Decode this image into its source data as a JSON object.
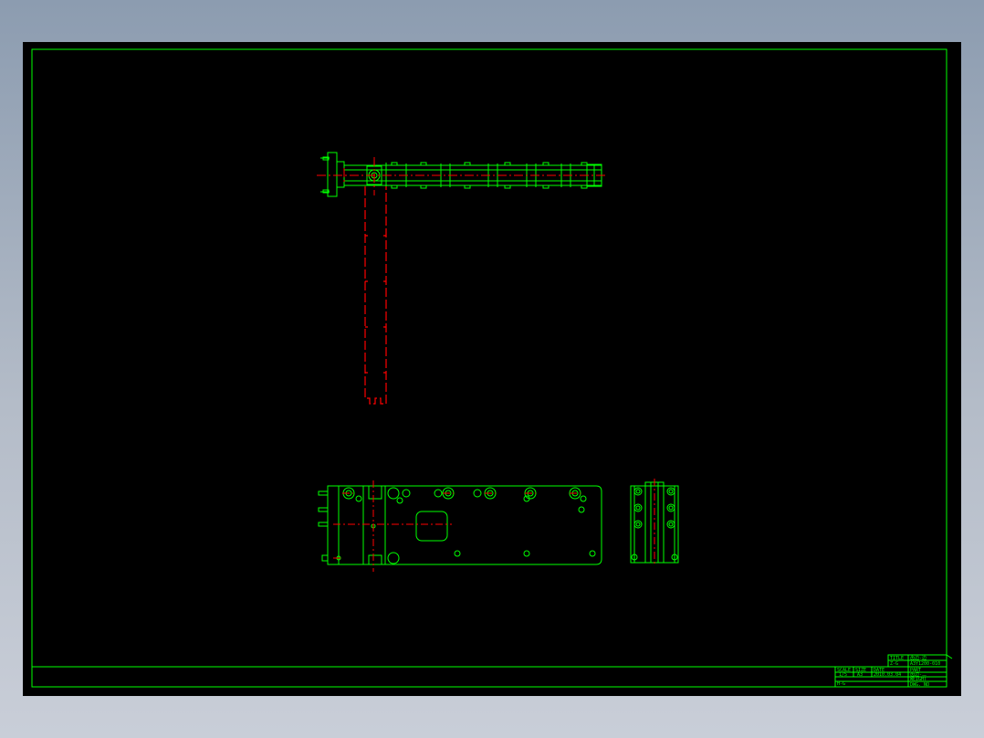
{
  "drawing": {
    "background_color": "#000000",
    "line_color": "#00ff00",
    "center_line_color": "#ff0000"
  },
  "title_block": {
    "title_label": "TITLE",
    "title_value": "齿边-边",
    "number_value": "Z-G",
    "part_label": "PART",
    "part_value": "齿边-二",
    "scale_label": "SCALE",
    "scale_value": "1/5",
    "size_label": "SIZE",
    "size_value": "A3",
    "date_label": "DATE",
    "date_value": "2010.03.04",
    "weight_label": "WEIGHT",
    "weight_value": "H-G",
    "drawing_no_label": "DWG. NO",
    "drawing_no_value": "A3Y1200-010"
  }
}
